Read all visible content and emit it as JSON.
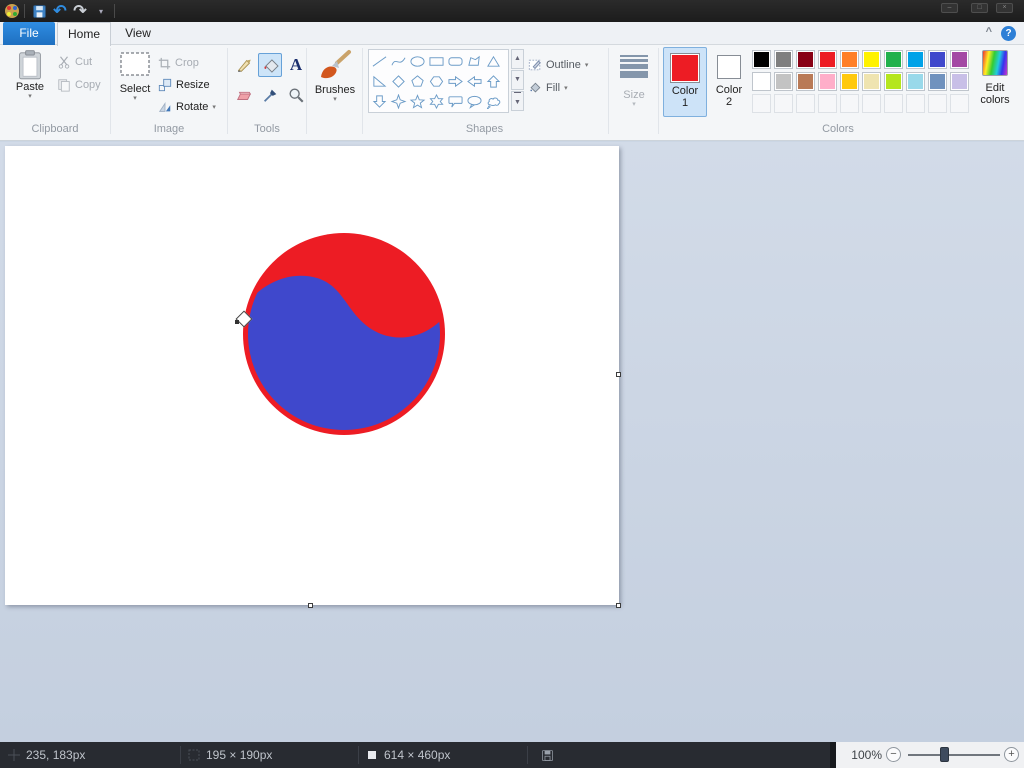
{
  "ui": {
    "caret": "▾",
    "scroll_up": "▲",
    "scroll_down": "▼",
    "scroll_more": "▼",
    "undo": "↶",
    "redo": "↷",
    "minimize_ribbon": "^",
    "help": "?",
    "window_min": "–",
    "window_max": "□",
    "window_close": "×"
  },
  "tabs": {
    "file": "File",
    "home": "Home",
    "view": "View"
  },
  "ribbon": {
    "clipboard": {
      "label": "Clipboard",
      "paste": "Paste",
      "cut": "Cut",
      "copy": "Copy"
    },
    "image": {
      "label": "Image",
      "select": "Select",
      "crop": "Crop",
      "resize": "Resize",
      "rotate": "Rotate"
    },
    "tools": {
      "label": "Tools",
      "selected_tool": "fill-with-color"
    },
    "brushes": {
      "label": "Brushes"
    },
    "shapes": {
      "label": "Shapes",
      "outline": "Outline",
      "fill": "Fill",
      "items": [
        "line",
        "curve",
        "ellipse",
        "rectangle",
        "rounded-rectangle",
        "polygon",
        "triangle",
        "right-triangle",
        "diamond",
        "pentagon",
        "hexagon",
        "arrow-right",
        "arrow-left",
        "arrow-up",
        "arrow-down",
        "star-4",
        "star-5",
        "star-6",
        "callout-rounded",
        "callout-oval",
        "callout-cloud"
      ]
    },
    "size": {
      "label": "Size"
    },
    "colors": {
      "label": "Colors",
      "color1_title": "Color",
      "color1_num": "1",
      "color1_value": "#ED1C24",
      "color2_title": "Color",
      "color2_num": "2",
      "color2_value": "#FFFFFF",
      "edit_line1": "Edit",
      "edit_line2": "colors",
      "palette_row1": [
        "#000000",
        "#7F7F7F",
        "#880015",
        "#ED1C24",
        "#FF7F27",
        "#FFF200",
        "#22B14C",
        "#00A2E8",
        "#3F48CC",
        "#A349A4"
      ],
      "palette_row2": [
        "#FFFFFF",
        "#C3C3C3",
        "#B97A57",
        "#FFAEC9",
        "#FFC90E",
        "#EFE4B0",
        "#B5E61D",
        "#99D9EA",
        "#7092BE",
        "#C8BFE7"
      ],
      "empty_slots": 10
    }
  },
  "canvas": {
    "drawing": {
      "circle_fill": "#ED1C24",
      "wave_fill": "#3F48CC"
    }
  },
  "status_bar": {
    "cursor_position": "235, 183px",
    "selection_size": "195 × 190px",
    "canvas_size": "614 × 460px",
    "zoom_level": "100%"
  }
}
